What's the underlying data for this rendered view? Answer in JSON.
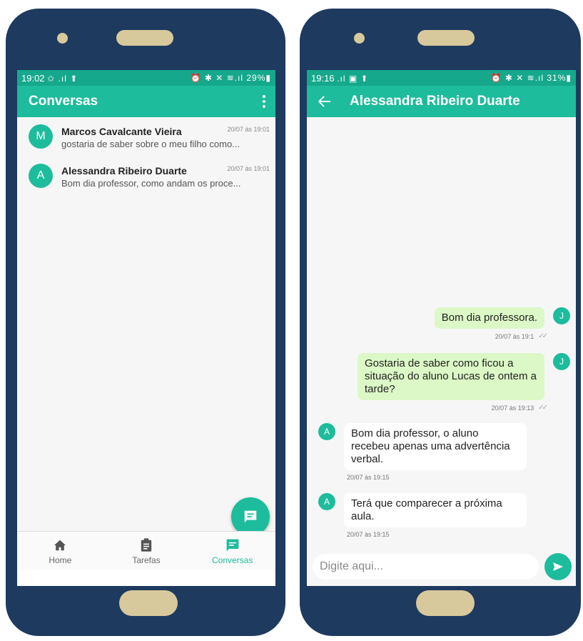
{
  "left": {
    "status": {
      "time": "19:02",
      "left_icons": "✩ .ıl ⬆",
      "right_icons": "⏰ ✱ ✕ ≋.ıl 29%▮"
    },
    "appbar": {
      "title": "Conversas",
      "menu_icon": "more-vert-icon"
    },
    "conversations": [
      {
        "initial": "M",
        "name": "Marcos Cavalcante Vieira",
        "message": "gostaria de saber sobre o meu filho como...",
        "time": "20/07 às 19:01"
      },
      {
        "initial": "A",
        "name": "Alessandra Ribeiro Duarte",
        "message": "Bom dia professor, como andam os proce...",
        "time": "20/07 às 19:01"
      }
    ],
    "fab_icon": "chat-icon",
    "nav": [
      {
        "label": "Home",
        "icon": "home-icon",
        "active": false
      },
      {
        "label": "Tarefas",
        "icon": "clipboard-icon",
        "active": false
      },
      {
        "label": "Conversas",
        "icon": "chat-icon",
        "active": true
      }
    ]
  },
  "right": {
    "status": {
      "time": "19:16",
      "left_icons": ".ıl ▣ ⬆",
      "right_icons": "⏰ ✱ ✕ ≋.ıl 31%▮"
    },
    "appbar": {
      "title": "Alessandra Ribeiro Duarte",
      "back_icon": "arrow-back-icon"
    },
    "messages": [
      {
        "direction": "out",
        "avatar": "J",
        "text": "Bom dia professora.",
        "time": "20/07 às 19:1"
      },
      {
        "direction": "out",
        "avatar": "J",
        "text": "Gostaria de saber como ficou a situação do aluno Lucas de ontem a tarde?",
        "time": "20/07 às 19:13"
      },
      {
        "direction": "in",
        "avatar": "A",
        "text": "Bom dia professor, o aluno recebeu apenas uma advertência verbal.",
        "time": "20/07 às 19:15"
      },
      {
        "direction": "in",
        "avatar": "A",
        "text": "Terá que comparecer a próxima aula.",
        "time": "20/07 às 19:15"
      }
    ],
    "input": {
      "placeholder": "Digite aqui...",
      "value": ""
    },
    "send_icon": "send-icon"
  },
  "colors": {
    "accent": "#1dbc9c",
    "accent_dark": "#16a88c",
    "outgoing_bubble": "#dcf8c6",
    "phone_body": "#1e3a5f",
    "phone_buttons": "#d8c99c"
  }
}
